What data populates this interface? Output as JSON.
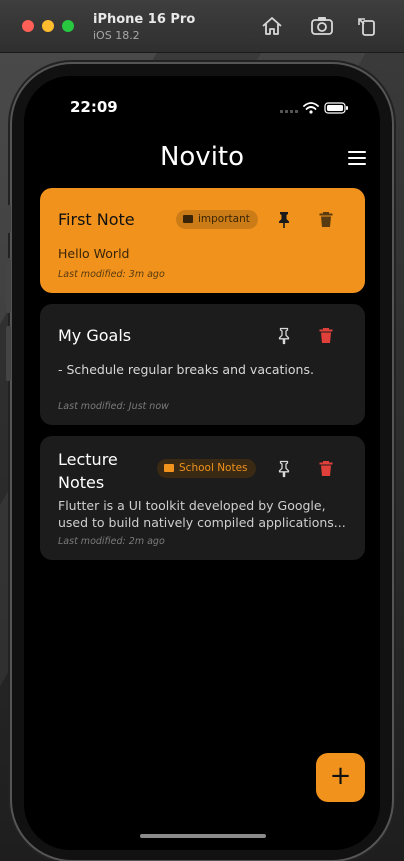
{
  "simulator": {
    "device_name": "iPhone 16 Pro",
    "os_version": "iOS 18.2",
    "icons": [
      "home-icon",
      "screenshot-icon",
      "rotate-icon"
    ]
  },
  "status_bar": {
    "time": "22:09"
  },
  "app": {
    "title": "Novito"
  },
  "notes": [
    {
      "title": "First Note",
      "tag": "important",
      "body": "Hello World",
      "meta": "Last modified: 3m ago",
      "pinned": true,
      "color": "#f0921c"
    },
    {
      "title": "My Goals",
      "tag": "",
      "body": "- Schedule regular breaks and vacations.",
      "meta": "Last modified: Just now",
      "pinned": false,
      "color": "#1c1c1c"
    },
    {
      "title": "Lecture Notes",
      "tag": "School Notes",
      "body_lines": [
        "Flutter is a UI toolkit developed by Google,",
        "used to build natively compiled applications..."
      ],
      "meta": "Last modified: 2m ago",
      "pinned": false,
      "color": "#1c1c1c"
    }
  ],
  "fab": {
    "label": "+"
  },
  "colors": {
    "accent": "#f0921c",
    "delete": "#e0403a",
    "background": "#000000",
    "card": "#1c1c1c"
  }
}
